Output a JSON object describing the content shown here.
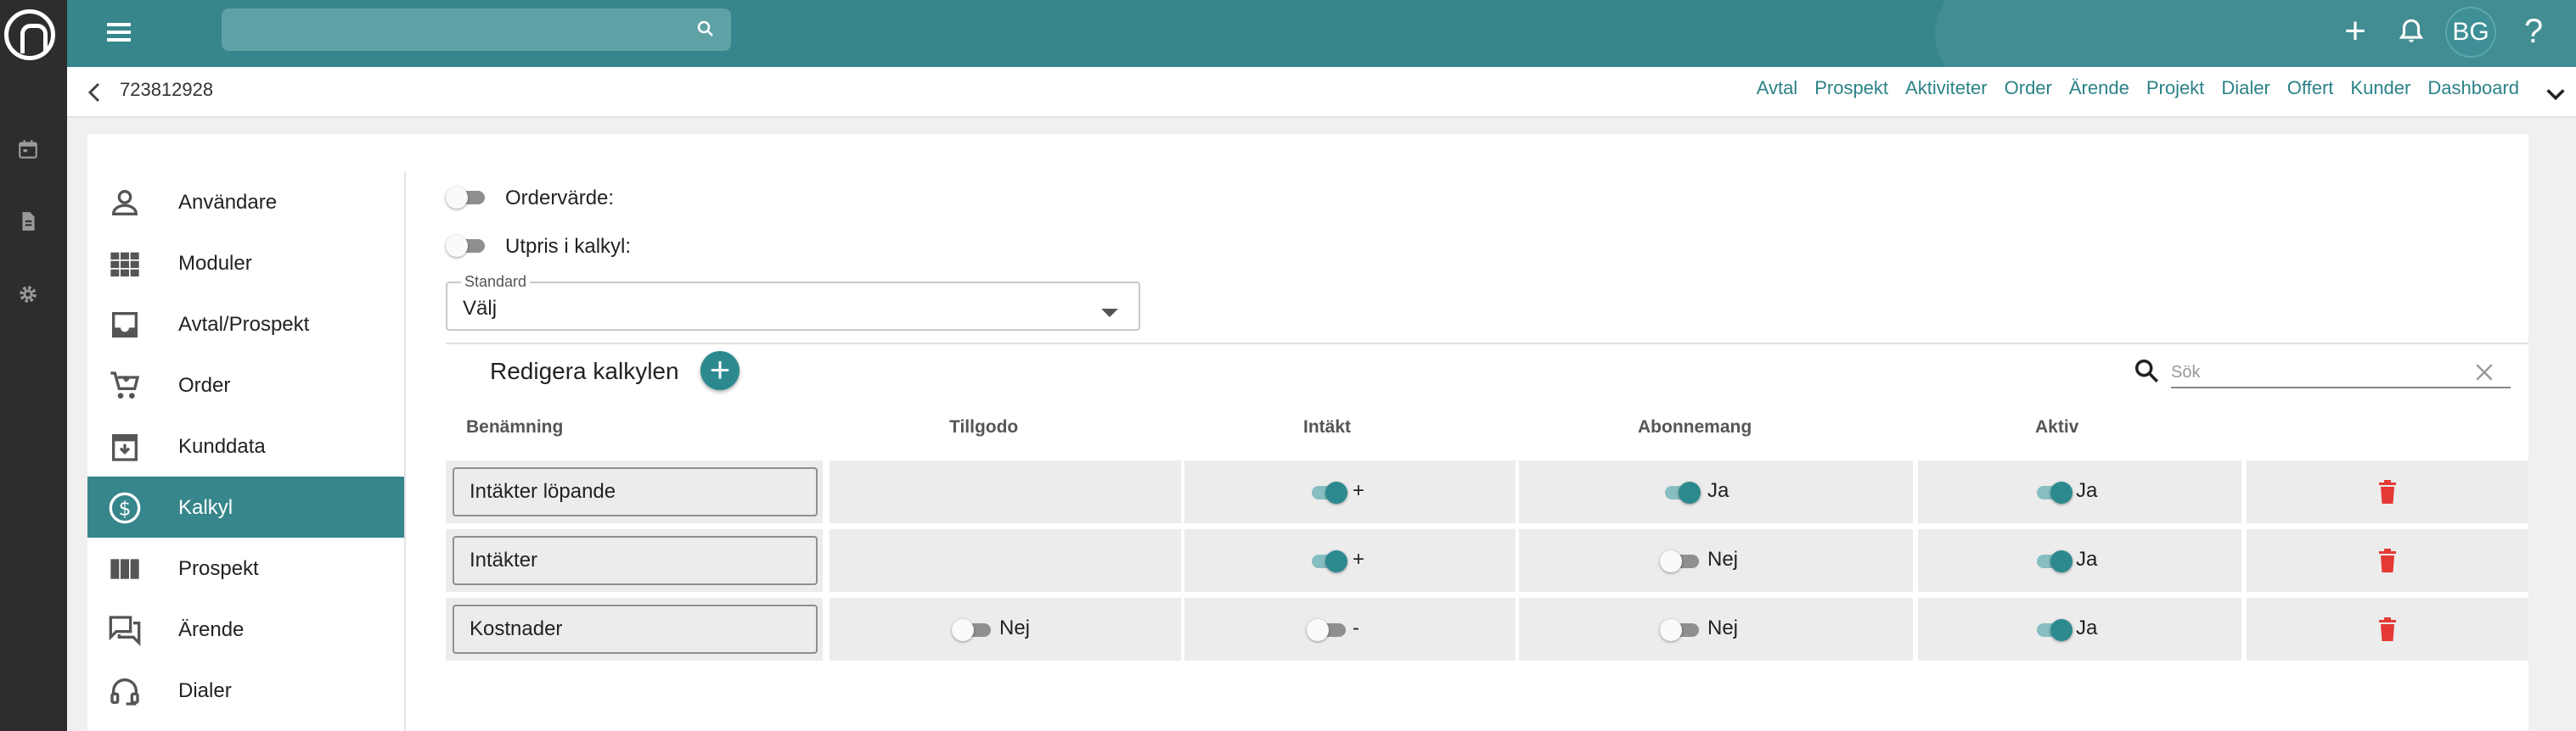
{
  "topbar": {
    "search_value": ""
  },
  "subheader": {
    "record_id": "723812928",
    "links": [
      "Avtal",
      "Prospekt",
      "Aktiviteter",
      "Order",
      "Ärende",
      "Projekt",
      "Dialer",
      "Offert",
      "Kunder",
      "Dashboard"
    ]
  },
  "user": {
    "initials": "BG"
  },
  "sidebar": {
    "items": [
      {
        "label": "Användare"
      },
      {
        "label": "Moduler"
      },
      {
        "label": "Avtal/Prospekt"
      },
      {
        "label": "Order"
      },
      {
        "label": "Kunddata"
      },
      {
        "label": "Kalkyl"
      },
      {
        "label": "Prospekt"
      },
      {
        "label": "Ärende"
      },
      {
        "label": "Dialer"
      }
    ],
    "active": "Kalkyl"
  },
  "settings": {
    "ordervarde_label": "Ordervärde:",
    "ordervarde_on": false,
    "utpris_label": "Utpris i kalkyl:",
    "utpris_on": false,
    "standard_legend": "Standard",
    "standard_value": "Välj"
  },
  "kalkyl": {
    "title": "Redigera kalkylen",
    "search_placeholder": "Sök",
    "columns": [
      "Benämning",
      "Tillgodo",
      "Intäkt",
      "Abonnemang",
      "Aktiv"
    ],
    "rows": [
      {
        "name": "Intäkter löpande",
        "tillgodo": null,
        "intakt": {
          "on": true,
          "text": "+"
        },
        "abonnemang": {
          "on": true,
          "text": "Ja"
        },
        "aktiv": {
          "on": true,
          "text": "Ja"
        }
      },
      {
        "name": "Intäkter",
        "tillgodo": null,
        "intakt": {
          "on": true,
          "text": "+"
        },
        "abonnemang": {
          "on": false,
          "text": "Nej"
        },
        "aktiv": {
          "on": true,
          "text": "Ja"
        }
      },
      {
        "name": "Kostnader",
        "tillgodo": {
          "on": false,
          "text": "Nej"
        },
        "intakt": {
          "on": false,
          "text": "-"
        },
        "abonnemang": {
          "on": false,
          "text": "Nej"
        },
        "aktiv": {
          "on": true,
          "text": "Ja"
        }
      }
    ]
  },
  "colors": {
    "brand": "#36868c",
    "accent": "#2c8a8f",
    "danger": "#e53935",
    "rail": "#2d2d2d"
  },
  "icons": {
    "rail": [
      "calendar-icon",
      "document-icon",
      "gear-icon"
    ],
    "topbar": [
      "menu-icon",
      "search-icon",
      "plus-icon",
      "bell-icon",
      "help-icon"
    ],
    "sidebar": [
      "person-icon",
      "grid-icon",
      "inbox-icon",
      "cart-icon",
      "archive-icon",
      "dollar-icon",
      "columns-icon",
      "chat-icon",
      "headset-icon"
    ]
  }
}
